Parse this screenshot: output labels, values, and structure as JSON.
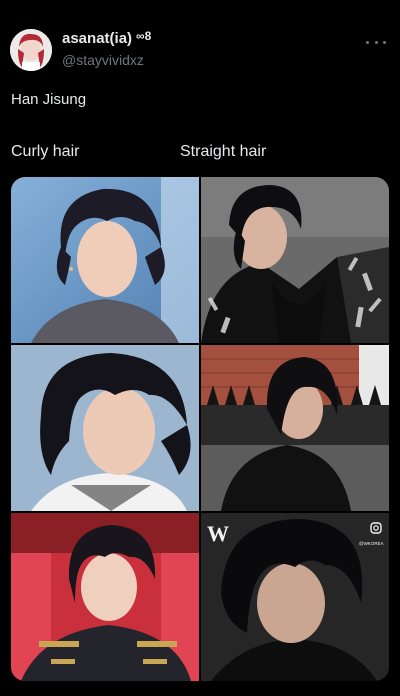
{
  "user": {
    "display_name": "asanat(ia)",
    "badge": "∞8",
    "handle": "@stayvividxz"
  },
  "tweet": {
    "text": "Han Jisung",
    "label_left": "Curly hair",
    "label_right": "Straight hair"
  },
  "photos": [
    {
      "name": "photo-curly-1",
      "accent": "#7aa0c8"
    },
    {
      "name": "photo-straight-1",
      "accent": "#2a2a2a"
    },
    {
      "name": "photo-curly-2",
      "accent": "#9bb4cc"
    },
    {
      "name": "photo-straight-2",
      "accent": "#8c3b2f"
    },
    {
      "name": "photo-curly-3",
      "accent": "#c7323a"
    },
    {
      "name": "photo-straight-3",
      "accent": "#1a1a1a"
    }
  ],
  "overlay": {
    "magazine_letter": "W",
    "brand_tag": "@WKOREA"
  }
}
